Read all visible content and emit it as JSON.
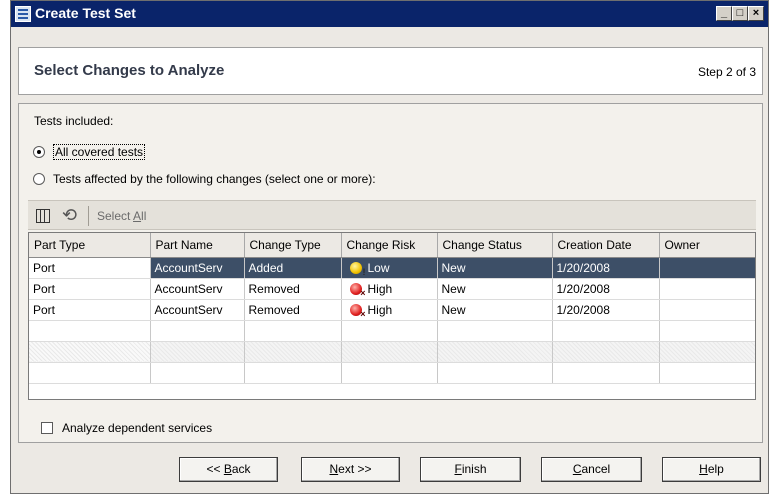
{
  "window": {
    "title": "Create Test Set"
  },
  "header": {
    "title": "Select Changes to Analyze",
    "step": "Step 2 of 3"
  },
  "tests_included": {
    "label": "Tests included:",
    "options": [
      {
        "label": "All covered tests",
        "checked": true
      },
      {
        "label": "Tests affected by the following changes (select one or more):",
        "checked": false
      }
    ]
  },
  "toolbar": {
    "columns_icon": "columns-icon",
    "refresh_icon": "refresh-icon",
    "select_all_prefix": "Select ",
    "select_all_mnemonic": "A",
    "select_all_suffix": "ll"
  },
  "table": {
    "columns": [
      "Part Type",
      "Part Name",
      "Change Type",
      "Change Risk",
      "Change Status",
      "Creation Date",
      "Owner"
    ],
    "rows": [
      {
        "part_type": "Port",
        "part_name": "AccountServ",
        "change_type": "Added",
        "change_risk": "Low",
        "risk_icon": "low-risk-icon",
        "change_status": "New",
        "creation_date": "1/20/2008",
        "owner": "",
        "selected": true
      },
      {
        "part_type": "Port",
        "part_name": "AccountServ",
        "change_type": "Removed",
        "change_risk": "High",
        "risk_icon": "high-risk-icon",
        "change_status": "New",
        "creation_date": "1/20/2008",
        "owner": "",
        "selected": false
      },
      {
        "part_type": "Port",
        "part_name": "AccountServ",
        "change_type": "Removed",
        "change_risk": "High",
        "risk_icon": "high-risk-icon",
        "change_status": "New",
        "creation_date": "1/20/2008",
        "owner": "",
        "selected": false
      }
    ]
  },
  "analyze_dependent": {
    "label": "Analyze dependent services",
    "checked": false
  },
  "buttons": {
    "back_prefix": "<< ",
    "back_mnemonic": "B",
    "back_suffix": "ack",
    "next_mnemonic": "N",
    "next_suffix": "ext >>",
    "finish_mnemonic": "F",
    "finish_suffix": "inish",
    "cancel_mnemonic": "C",
    "cancel_suffix": "ancel",
    "help_mnemonic": "H",
    "help_suffix": "elp"
  },
  "colors": {
    "titlebar": "#0a246a",
    "selected_row": "#3d4f67",
    "dialog_bg": "#ece9e4"
  }
}
